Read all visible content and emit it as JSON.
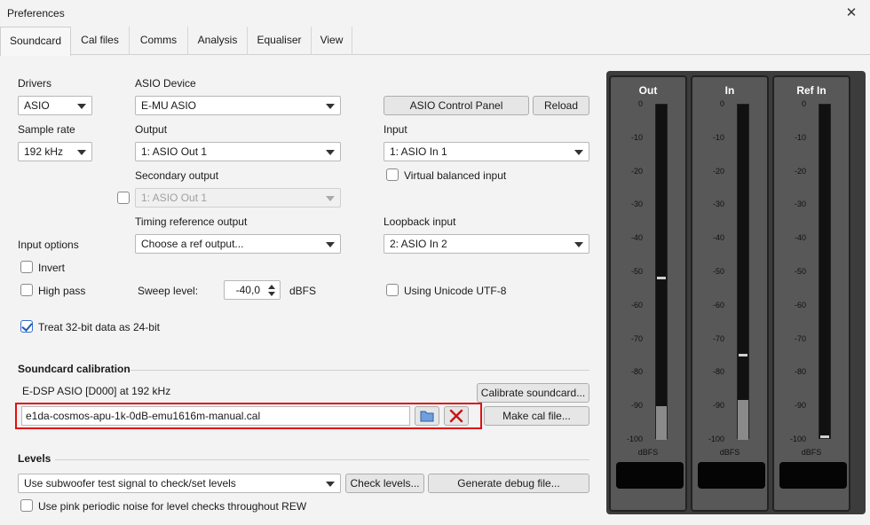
{
  "window": {
    "title": "Preferences"
  },
  "tabs": [
    "Soundcard",
    "Cal files",
    "Comms",
    "Analysis",
    "Equaliser",
    "View"
  ],
  "drivers": {
    "label": "Drivers",
    "value": "ASIO"
  },
  "asio_device": {
    "label": "ASIO Device",
    "value": "E-MU ASIO"
  },
  "asio_control_panel": "ASIO Control Panel",
  "reload": "Reload",
  "sample_rate": {
    "label": "Sample rate",
    "value": "192 kHz"
  },
  "output": {
    "label": "Output",
    "value": "1: ASIO Out 1"
  },
  "input": {
    "label": "Input",
    "value": "1: ASIO In 1"
  },
  "secondary_output": {
    "label": "Secondary output",
    "value": "1: ASIO Out 1"
  },
  "virtual_balanced": "Virtual balanced input",
  "timing_ref": {
    "label": "Timing reference output",
    "value": "Choose a ref output..."
  },
  "loopback": {
    "label": "Loopback input",
    "value": "2: ASIO In 2"
  },
  "input_options": "Input options",
  "invert": "Invert",
  "high_pass": "High pass",
  "sweep_level": {
    "label": "Sweep level:",
    "value": "-40,0",
    "unit": "dBFS"
  },
  "unicode": "Using Unicode UTF-8",
  "treat_32": "Treat 32-bit data as 24-bit",
  "calibration": {
    "header": "Soundcard calibration",
    "device": "E-DSP ASIO [D000] at 192 kHz",
    "calibrate_button": "Calibrate soundcard...",
    "file": "e1da-cosmos-apu-1k-0dB-emu1616m-manual.cal",
    "make_cal": "Make cal file..."
  },
  "levels": {
    "header": "Levels",
    "mode": "Use subwoofer test signal to check/set levels",
    "check_levels": "Check levels...",
    "debug": "Generate debug file...",
    "pink_noise": "Use pink periodic noise for level checks throughout REW"
  },
  "meters": {
    "scale": [
      "0",
      "-10",
      "-20",
      "-30",
      "-40",
      "-50",
      "-60",
      "-70",
      "-80",
      "-90",
      "-100"
    ],
    "unit": "dBFS",
    "channels": [
      {
        "name": "Out",
        "level_db": -90,
        "peak_db": -51.5
      },
      {
        "name": "In",
        "level_db": -88,
        "peak_db": -74.5
      },
      {
        "name": "Ref In",
        "level_db": -100,
        "peak_db": -99
      }
    ]
  },
  "colors": {
    "highlight": "#e01010",
    "checkbox_accent": "#1e5bbf",
    "meter_bg": "#3c3c3c"
  }
}
